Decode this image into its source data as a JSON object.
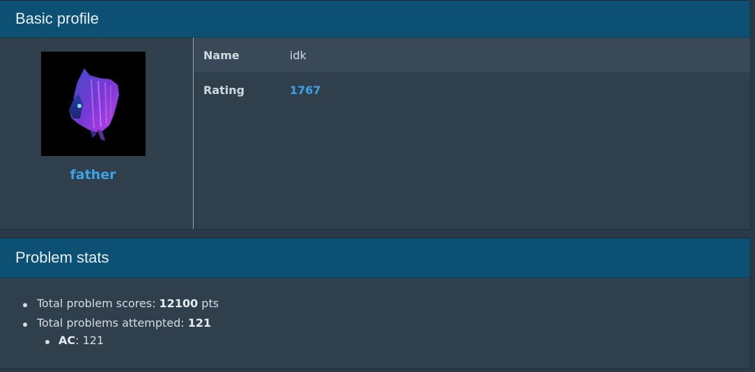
{
  "profile_panel": {
    "title": "Basic profile",
    "username": "father",
    "fields": [
      {
        "key": "Name",
        "value": "idk"
      },
      {
        "key": "Rating",
        "value": "1767"
      }
    ]
  },
  "stats_panel": {
    "title": "Problem stats",
    "total_scores_label": "Total problem scores: ",
    "total_scores_value": "12100",
    "total_scores_unit": " pts",
    "attempted_label": "Total problems attempted: ",
    "attempted_value": "121",
    "ac_label": "AC",
    "ac_value": ": 121"
  },
  "colors": {
    "header": "#0c5174",
    "panel_bg": "#303f4c",
    "link": "#3ea2e6"
  }
}
